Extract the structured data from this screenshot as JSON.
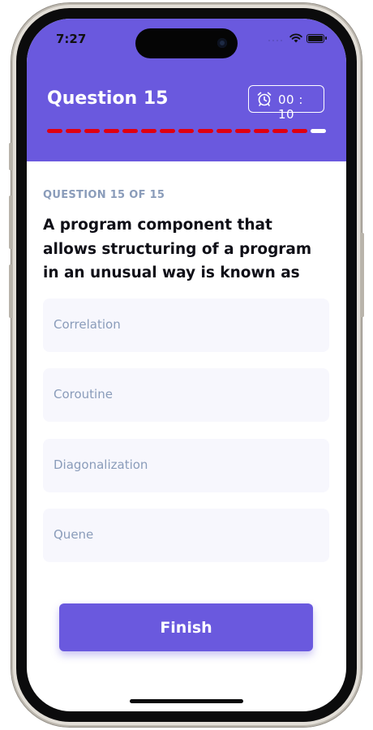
{
  "status_bar": {
    "time": "7:27",
    "icons": [
      "signal-icon",
      "wifi-icon",
      "battery-icon"
    ]
  },
  "header": {
    "title": "Question 15",
    "timer": "00 : 10",
    "timer_icon": "alarm-clock-icon",
    "progress": {
      "total": 15,
      "current": 15,
      "answered_color": "#e00010",
      "current_color": "#ffffff"
    }
  },
  "question": {
    "counter": "QUESTION 15 OF 15",
    "text": "A program component that allows structuring of a program in an unusual way is known as"
  },
  "options": [
    "Correlation",
    "Coroutine",
    "Diagonalization",
    "Quene"
  ],
  "actions": {
    "finish_label": "Finish"
  },
  "colors": {
    "accent": "#6a59de",
    "muted_text": "#8a9cba",
    "option_bg": "#f7f7fd"
  }
}
